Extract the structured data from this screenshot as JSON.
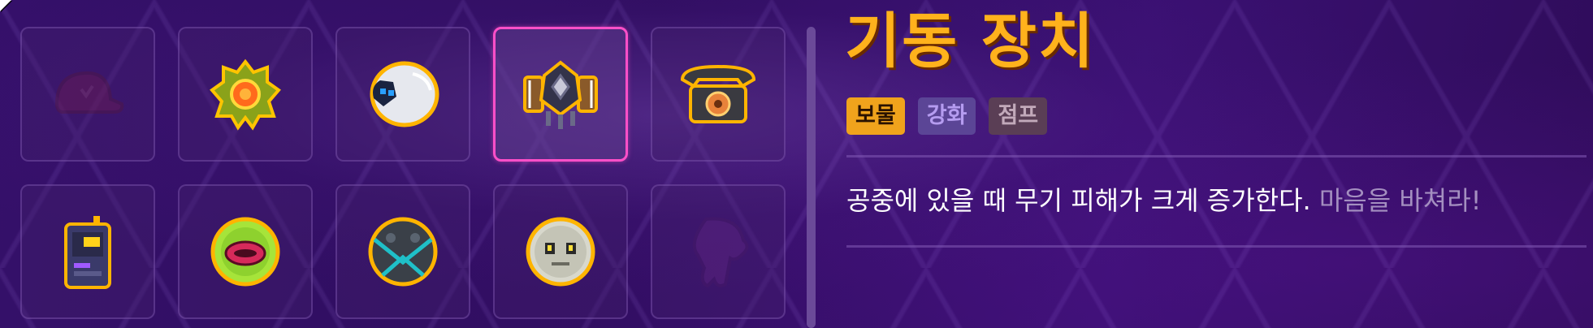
{
  "title": "기동 장치",
  "tags": {
    "treasure": "보물",
    "upgrade": "강화",
    "jump": "점프"
  },
  "description": {
    "main": "공중에 있을 때 무기 피해가 크게 증가한다.",
    "flavor": "마음을 바쳐라!"
  },
  "colors": {
    "title": "#ffb21c",
    "selected_border": "#ff4fc8",
    "tag_treasure": "#f0a31c",
    "tag_upgrade": "#5b4596",
    "tag_jump": "#5a3e55"
  },
  "slots": [
    {
      "icon": "cap-icon",
      "state": "faded"
    },
    {
      "icon": "flower-icon",
      "state": "normal"
    },
    {
      "icon": "white-orb-icon",
      "state": "normal"
    },
    {
      "icon": "jetpack-icon",
      "state": "selected"
    },
    {
      "icon": "telephone-icon",
      "state": "normal"
    },
    {
      "icon": "gameboy-icon",
      "state": "normal"
    },
    {
      "icon": "lips-orb-icon",
      "state": "normal"
    },
    {
      "icon": "dark-orb-icon",
      "state": "normal"
    },
    {
      "icon": "skull-coin-icon",
      "state": "normal"
    },
    {
      "icon": "ghost-icon",
      "state": "faded"
    }
  ]
}
